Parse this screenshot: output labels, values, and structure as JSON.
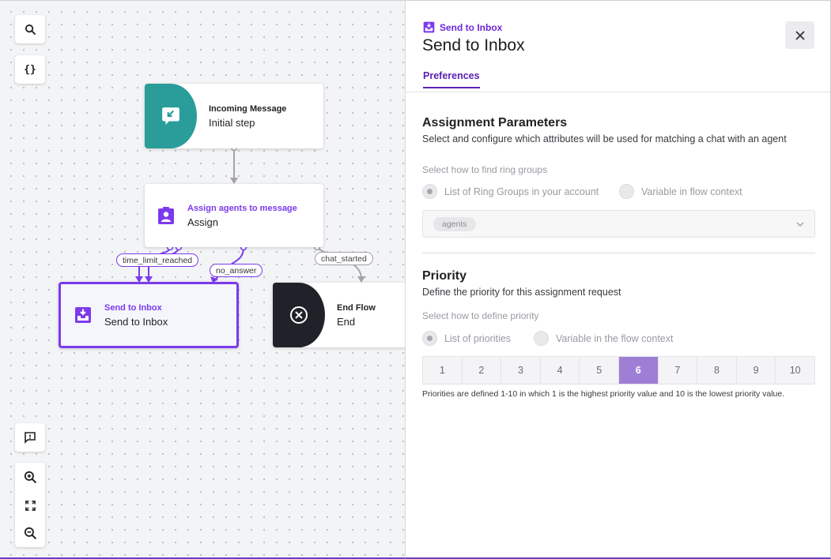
{
  "canvas": {
    "tools": {
      "search_icon": "search-icon",
      "variables_label": "{}",
      "feedback_icon": "feedback-icon",
      "zoom_in_icon": "zoom-in-icon",
      "fit_icon": "fit-view-icon",
      "zoom_out_icon": "zoom-out-icon"
    },
    "nodes": {
      "incoming": {
        "kind": "Incoming Message",
        "name": "Initial step",
        "color": "#2a9d9a"
      },
      "assign": {
        "kind": "Assign agents to message",
        "name": "Assign",
        "color": "#7c3aed"
      },
      "send_inbox": {
        "kind": "Send to Inbox",
        "name": "Send to Inbox",
        "color": "#7c3aed"
      },
      "end_flow": {
        "kind": "End Flow",
        "name": "End",
        "color": "#1f2329"
      }
    },
    "edges": {
      "time_limit": "time_limit_reached",
      "no_answer": "no_answer",
      "chat_started": "chat_started"
    }
  },
  "panel": {
    "eyebrow": "Send to Inbox",
    "title": "Send to Inbox",
    "close_icon": "close-icon",
    "tab": "Preferences",
    "assignment": {
      "title": "Assignment Parameters",
      "description": "Select and configure which attributes will be used for matching a chat with an agent",
      "field_label": "Select how to find ring groups",
      "options": [
        "List of Ring Groups in your account",
        "Variable in flow context"
      ],
      "selected_option": "List of Ring Groups in your account",
      "chip": "agents"
    },
    "priority": {
      "title": "Priority",
      "description": "Define the priority for this assignment request",
      "field_label": "Select how to define priority",
      "options": [
        "List of priorities",
        "Variable in the flow context"
      ],
      "selected_option": "List of priorities",
      "values": [
        "1",
        "2",
        "3",
        "4",
        "5",
        "6",
        "7",
        "8",
        "9",
        "10"
      ],
      "selected": "6",
      "hint": "Priorities are defined 1-10 in which 1 is the highest priority value and 10 is the lowest priority value."
    },
    "accent": "#6d28d9"
  }
}
